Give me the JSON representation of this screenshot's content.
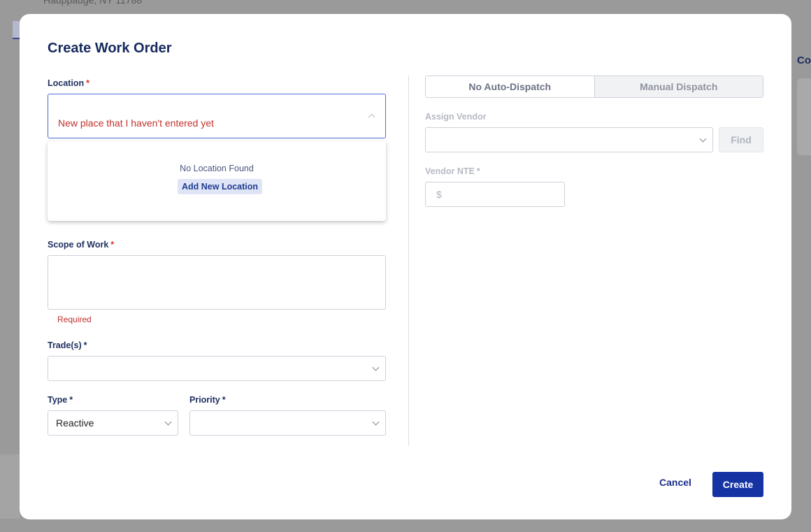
{
  "background": {
    "address_fragment": "Hauppauge, NY 11788",
    "right_fragment": "Co"
  },
  "modal": {
    "title": "Create Work Order"
  },
  "location": {
    "label": "Location",
    "required_mark": "*",
    "value": "New place that I haven't entered yet",
    "dropdown": {
      "empty_message": "No Location Found",
      "add_button": "Add New Location"
    }
  },
  "scope": {
    "label": "Scope of Work",
    "required_mark": "*",
    "value": "",
    "error": "Required"
  },
  "trades": {
    "label": "Trade(s)",
    "required_mark": "*",
    "value": ""
  },
  "type": {
    "label": "Type",
    "required_mark": "*",
    "value": "Reactive"
  },
  "priority": {
    "label": "Priority",
    "required_mark": "*",
    "value": ""
  },
  "dispatch": {
    "options": [
      "No Auto-Dispatch",
      "Manual Dispatch"
    ]
  },
  "vendor": {
    "label": "Assign Vendor",
    "value": "",
    "find_button": "Find"
  },
  "vendor_nte": {
    "label": "Vendor NTE",
    "required_mark": "*",
    "prefix": "$"
  },
  "footer": {
    "cancel_label": "Cancel",
    "create_label": "Create"
  },
  "colors": {
    "primary": "#1533a3",
    "title": "#17295e",
    "error": "#c0322b",
    "focus_border": "#4f6ad2"
  },
  "icons": [
    "chevron-up-icon",
    "chevron-down-icon"
  ]
}
